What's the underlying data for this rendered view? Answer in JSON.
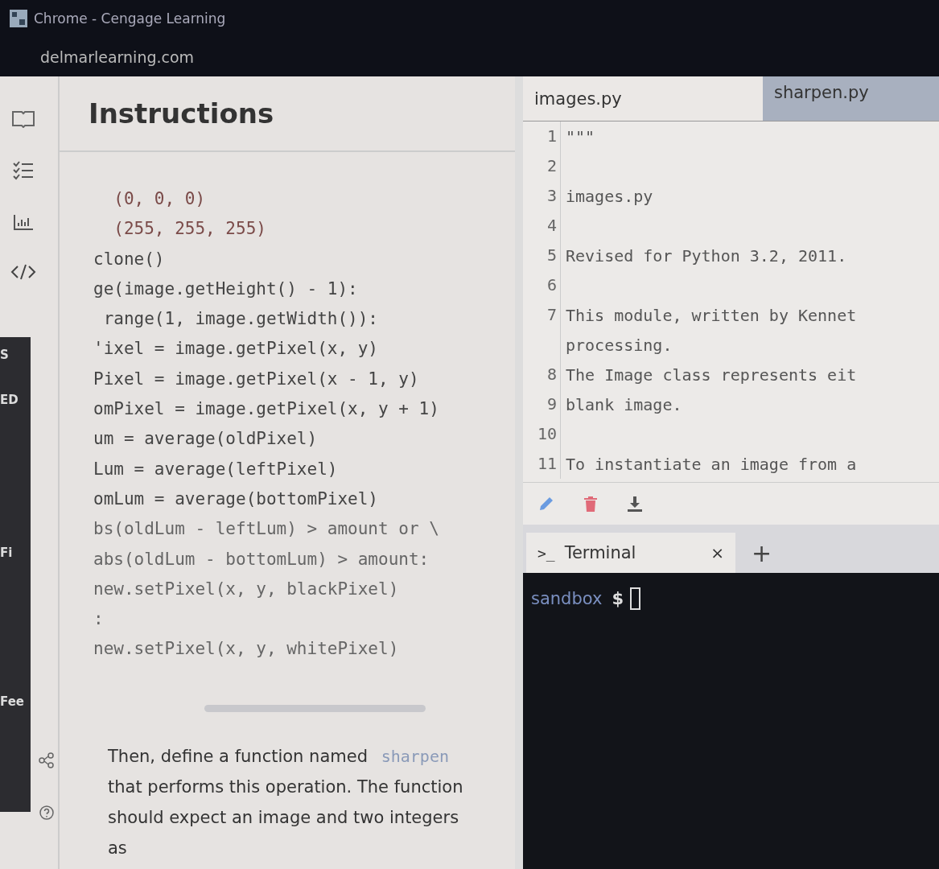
{
  "window": {
    "title": "Chrome - Cengage Learning",
    "url": "delmarlearning.com"
  },
  "rail": {
    "fragments": [
      "S",
      "ED",
      "Fi",
      "Fee"
    ]
  },
  "instructions": {
    "title": "Instructions",
    "code_lines": [
      {
        "text": "  (0, 0, 0)",
        "kind": "number"
      },
      {
        "text": "  (255, 255, 255)",
        "kind": "number"
      },
      {
        "text": "clone()",
        "kind": "plain"
      },
      {
        "text": "ge(image.getHeight() - 1):",
        "kind": "plain"
      },
      {
        "text": " range(1, image.getWidth()):",
        "kind": "plain"
      },
      {
        "text": "'ixel = image.getPixel(x, y)",
        "kind": "plain"
      },
      {
        "text": "Pixel = image.getPixel(x - 1, y)",
        "kind": "plain"
      },
      {
        "text": "omPixel = image.getPixel(x, y + 1)",
        "kind": "plain"
      },
      {
        "text": "um = average(oldPixel)",
        "kind": "plain"
      },
      {
        "text": "Lum = average(leftPixel)",
        "kind": "plain"
      },
      {
        "text": "omLum = average(bottomPixel)",
        "kind": "plain"
      },
      {
        "text": "bs(oldLum - leftLum) > amount or \\",
        "kind": "muted"
      },
      {
        "text": "abs(oldLum - bottomLum) > amount:",
        "kind": "muted"
      },
      {
        "text": "new.setPixel(x, y, blackPixel)",
        "kind": "muted"
      },
      {
        "text": ":",
        "kind": "muted"
      },
      {
        "text": "new.setPixel(x, y, whitePixel)",
        "kind": "muted"
      }
    ],
    "paragraph": "Then, define a function named ",
    "inline_code": "sharpen",
    "paragraph_rest": "that performs this operation. The function should expect an image and two integers as"
  },
  "editor": {
    "tabs": [
      {
        "label": "images.py",
        "selected": true
      },
      {
        "label": "sharpen.py",
        "selected": false
      }
    ],
    "lines": [
      {
        "number": "1",
        "text": "\"\"\""
      },
      {
        "number": "2"
      },
      {
        "number": "3",
        "text": "images.py"
      },
      {
        "number": "4"
      },
      {
        "number": "5",
        "text": "Revised for Python 3.2, 2011."
      },
      {
        "number": "6"
      },
      {
        "number": "7",
        "text": "This module, written by Kennet"
      },
      {
        "text": "processing."
      },
      {
        "number": "8",
        "text": "The Image class represents eit"
      },
      {
        "number": "9",
        "text": "blank image."
      },
      {
        "number": "10"
      },
      {
        "number": "11",
        "text": "To instantiate an image from a"
      }
    ]
  },
  "terminal": {
    "tab_icon": ">_",
    "tab_label": "Terminal",
    "close": "×",
    "add": "+",
    "prompt": "sandbox",
    "prompt_symbol": "$"
  }
}
